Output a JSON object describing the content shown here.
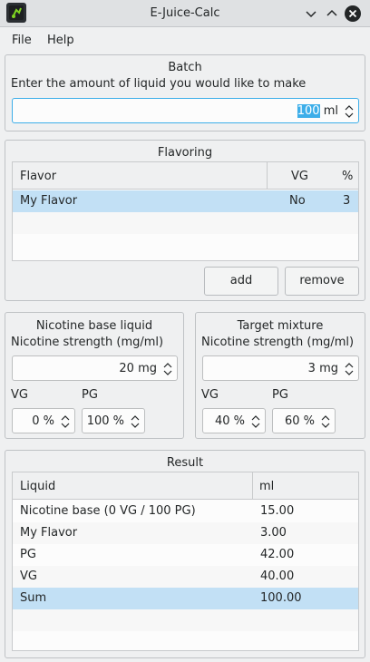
{
  "window": {
    "title": "E-Juice-Calc"
  },
  "menu": {
    "file": "File",
    "help": "Help"
  },
  "batch": {
    "title": "Batch",
    "prompt": "Enter the amount of liquid you would like to make",
    "amount_value": "100",
    "amount_unit": "ml"
  },
  "flavoring": {
    "title": "Flavoring",
    "headers": {
      "flavor": "Flavor",
      "vg": "VG",
      "percent": "%"
    },
    "rows": [
      {
        "flavor": "My Flavor",
        "vg": "No",
        "percent": "3"
      }
    ],
    "add_label": "add",
    "remove_label": "remove"
  },
  "nicotine_base": {
    "title": "Nicotine base liquid",
    "strength_label": "Nicotine strength (mg/ml)",
    "strength_value": "20 mg",
    "vg_label": "VG",
    "pg_label": "PG",
    "vg_value": "0 %",
    "pg_value": "100 %"
  },
  "target": {
    "title": "Target mixture",
    "strength_label": "Nicotine strength (mg/ml)",
    "strength_value": "3 mg",
    "vg_label": "VG",
    "pg_label": "PG",
    "vg_value": "40 %",
    "pg_value": "60 %"
  },
  "result": {
    "title": "Result",
    "headers": {
      "liquid": "Liquid",
      "ml": "ml"
    },
    "rows": [
      {
        "liquid": "Nicotine base (0 VG / 100 PG)",
        "ml": "15.00"
      },
      {
        "liquid": "My Flavor",
        "ml": "3.00"
      },
      {
        "liquid": "PG",
        "ml": "42.00"
      },
      {
        "liquid": "VG",
        "ml": "40.00"
      },
      {
        "liquid": "Sum",
        "ml": "100.00"
      }
    ]
  },
  "colors": {
    "accent": "#3daee9",
    "selection_row": "#c2e0f5",
    "window_bg": "#eff0f1",
    "close_button": "#232627"
  },
  "icons": {
    "app": "e-juice-app-icon",
    "minimize": "chevron-down-icon",
    "maximize": "chevron-up-icon",
    "close": "close-icon",
    "spin": "spin-arrows-icon"
  }
}
